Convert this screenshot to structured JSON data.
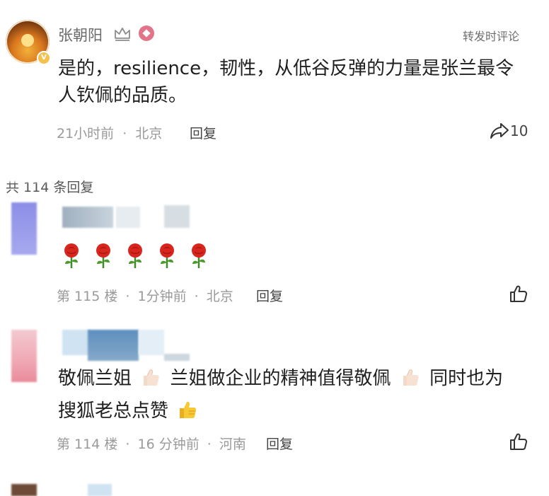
{
  "top_comment": {
    "username": "张朝阳",
    "forward_link": "转发时评论",
    "text": "是的，resilience，韧性，从低谷反弹的力量是张兰最令人钦佩的品质。",
    "time": "21小时前",
    "location": "北京",
    "reply_label": "回复",
    "share_count": "10"
  },
  "replies_header": "共 114 条回复",
  "replies": [
    {
      "floor": "第 115 楼",
      "time": "1分钟前",
      "location": "北京",
      "reply_label": "回复"
    },
    {
      "text_part1": "敬佩兰姐",
      "text_part2": "兰姐做企业的精神值得敬佩",
      "text_part3": "同时也为",
      "text_part4": "搜狐老总点赞",
      "floor": "第 114 楼",
      "time": "16 分钟前",
      "location": "河南",
      "reply_label": "回复"
    }
  ],
  "separator": "·",
  "icons": [
    "crown-icon",
    "vip-icon",
    "share-icon",
    "rose-emoji",
    "thumbs-up-emoji",
    "like-icon"
  ]
}
